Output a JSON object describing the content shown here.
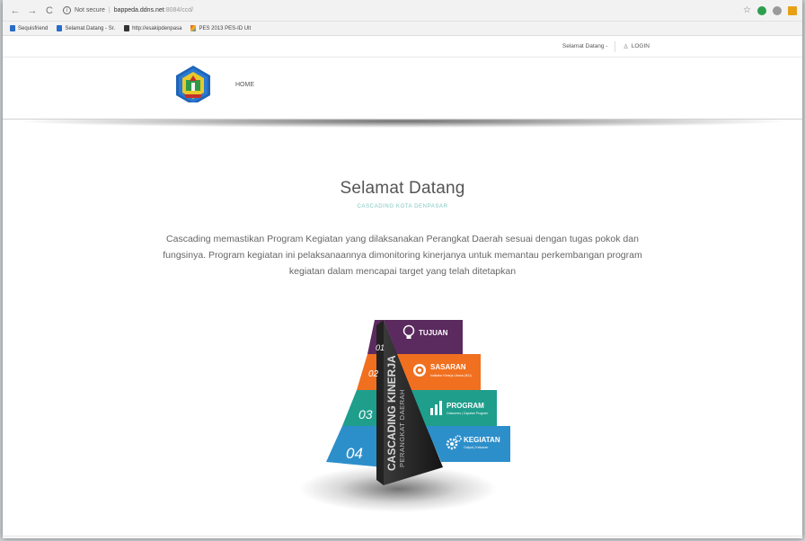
{
  "browser": {
    "url_secure_label": "Not secure",
    "url_host": "bappeda.ddns.net",
    "url_path": ":8084/ccd/",
    "bookmarks": [
      {
        "label": "Sequisfriend"
      },
      {
        "label": "Selamat Datang - Sr."
      },
      {
        "label": "http://esakipdenpasa"
      },
      {
        "label": "PES 2013 PES-ID Ult"
      }
    ]
  },
  "topbar": {
    "welcome_label": "Selamat Datang -",
    "login_label": "LOGIN"
  },
  "nav": {
    "home_label": "HOME"
  },
  "hero": {
    "title": "Selamat Datang",
    "subtitle": "CASCADING KOTA DENPASAR",
    "description": "Cascading memastikan Program Kegiatan yang dilaksanakan Perangkat Daerah sesuai dengan tugas pokok dan fungsinya. Program kegiatan ini pelaksanaannya dimonitoring kinerjanya untuk memantau perkembangan program kegiatan dalam mencapai target yang telah ditetapkan"
  },
  "pyramid": {
    "side_title": "CASCADING KINERJA",
    "side_subtitle": "PERANGKAT DAERAH",
    "levels": [
      {
        "number": "01",
        "label": "TUJUAN",
        "sub": "",
        "color": "#5b2a5e"
      },
      {
        "number": "02",
        "label": "SASARAN",
        "sub": "Indikator Kinerja Utama (IKU)",
        "color": "#f07020"
      },
      {
        "number": "03",
        "label": "PROGRAM",
        "sub": "Outcomes | Capaian Program",
        "color": "#1f9e8c"
      },
      {
        "number": "04",
        "label": "KEGIATAN",
        "sub": "Output | Keluaran",
        "color": "#2d8fca"
      }
    ]
  }
}
